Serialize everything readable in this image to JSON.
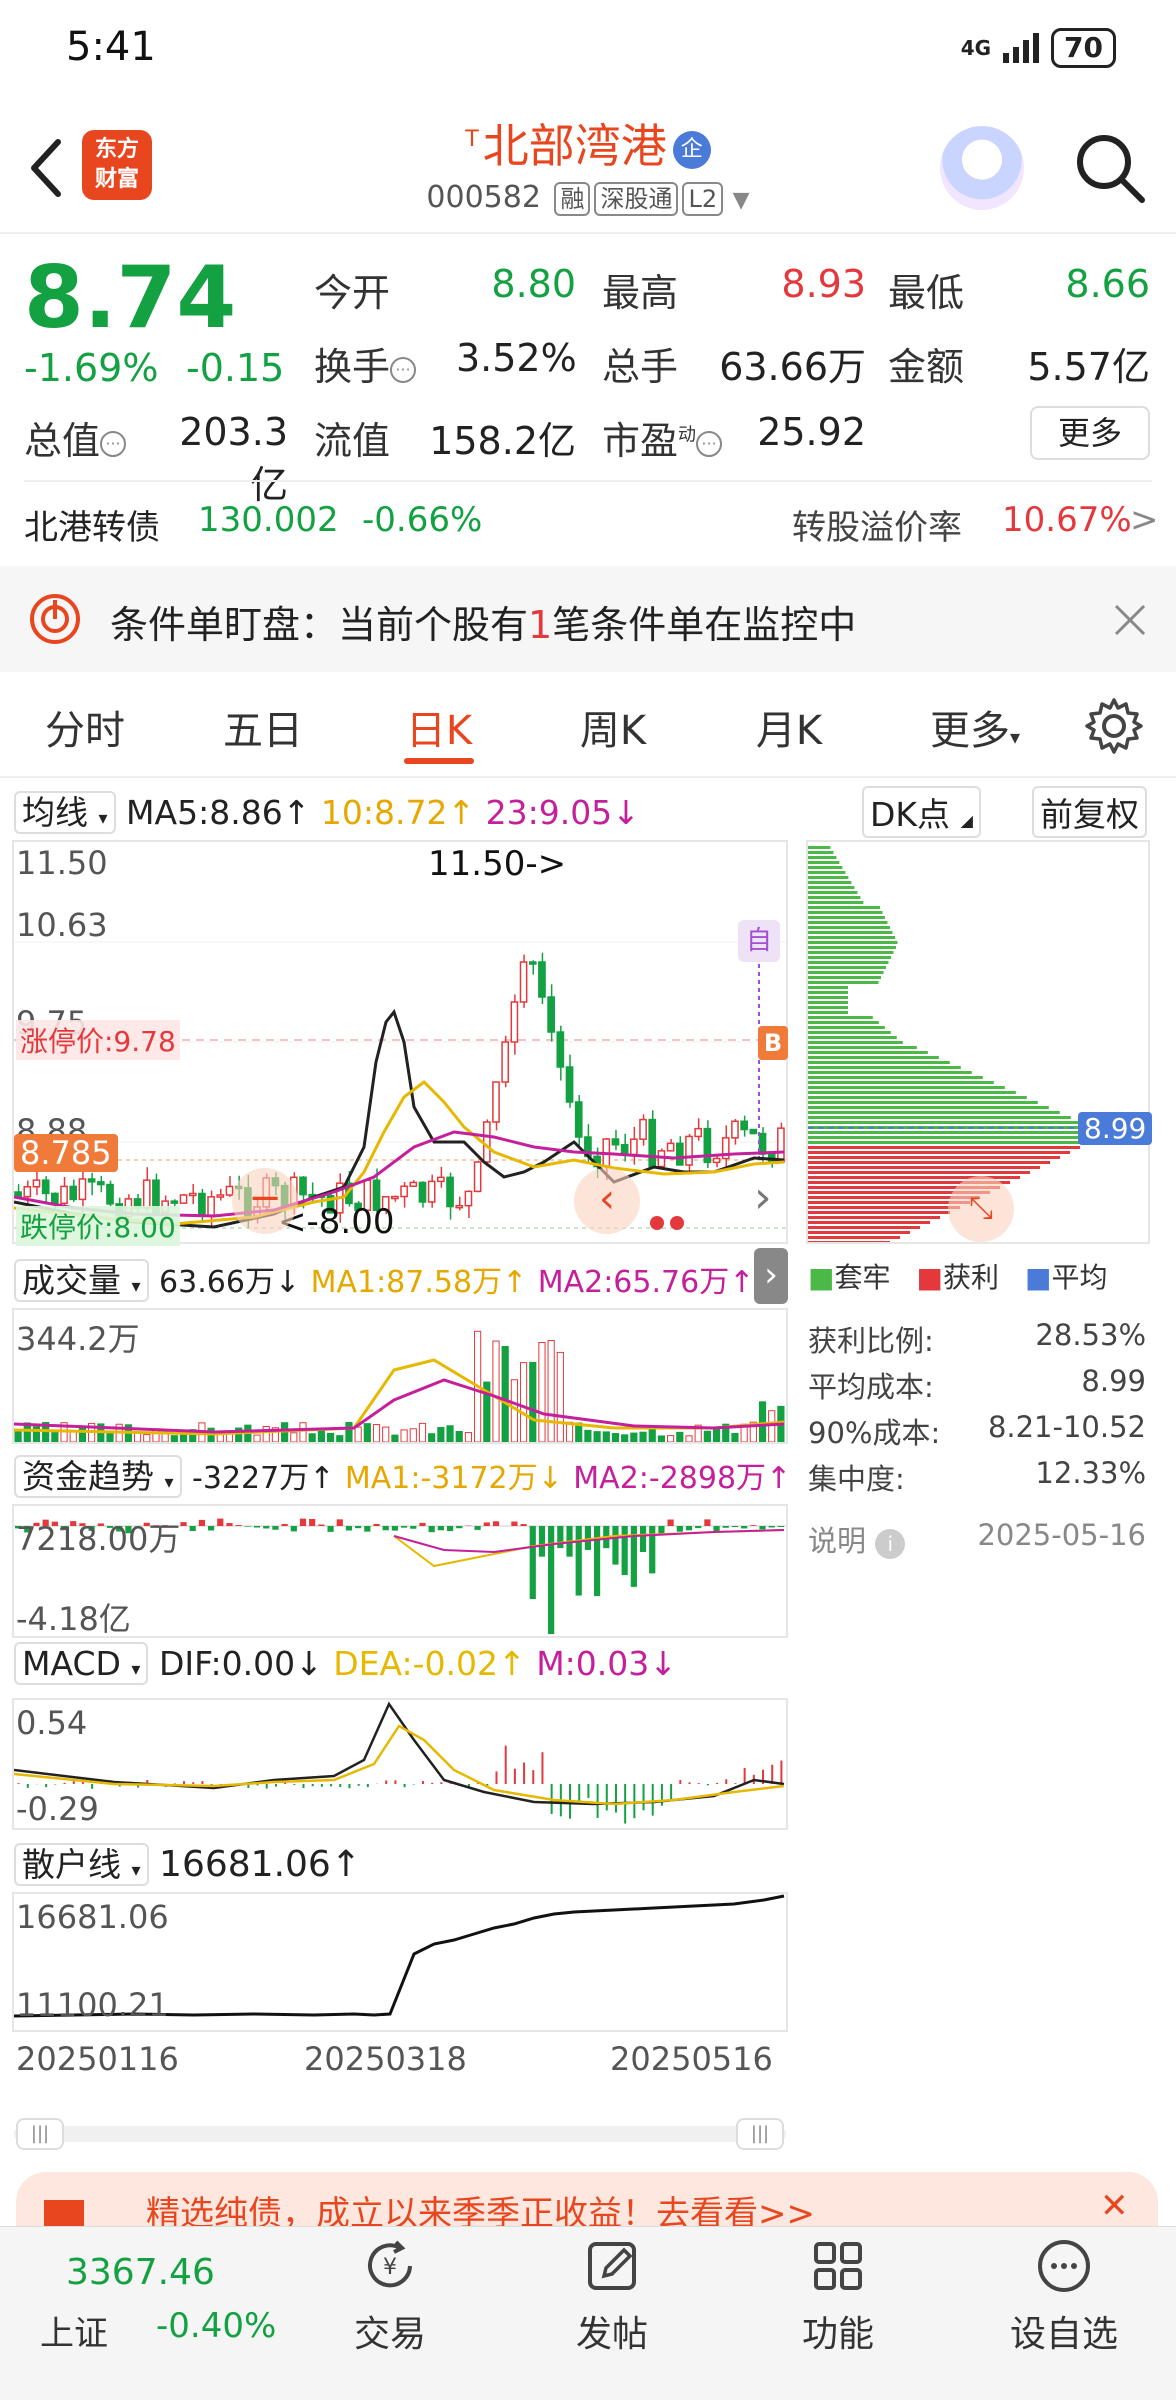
{
  "status": {
    "time": "5:41",
    "network": "4G",
    "battery": "70"
  },
  "header": {
    "app_logo": "东方\n财富",
    "name_prefix": "T",
    "stock_name": "北部湾港",
    "badge": "企",
    "code": "000582",
    "tags": [
      "融",
      "深股通",
      "L2"
    ]
  },
  "quote": {
    "price": "8.74",
    "change_pct": "-1.69%",
    "change": "-0.15",
    "market_cap_label": "总值",
    "market_cap": "203.3亿",
    "open_label": "今开",
    "open": "8.80",
    "high_label": "最高",
    "high": "8.93",
    "low_label": "最低",
    "low": "8.66",
    "turnover_label": "换手",
    "turnover": "3.52%",
    "volume_label": "总手",
    "volume": "63.66万",
    "amount_label": "金额",
    "amount": "5.57亿",
    "float_label": "流值",
    "float": "158.2亿",
    "pe_label": "市盈",
    "pe_sup": "动",
    "pe": "25.92",
    "more": "更多"
  },
  "bond": {
    "name": "北港转债",
    "price": "130.002",
    "pct": "-0.66%",
    "premium_label": "转股溢价率",
    "premium": "10.67%",
    "arrow": ">"
  },
  "condition_banner": {
    "text_a": "条件单盯盘：当前个股有",
    "count": "1",
    "text_b": "笔条件单在监控中"
  },
  "tabs": [
    "分时",
    "五日",
    "日K",
    "周K",
    "月K",
    "更多"
  ],
  "kline": {
    "ma_select": "均线",
    "ma5": "MA5:8.86↑",
    "ma10": "10:8.72↑",
    "ma23": "23:9.05↓",
    "dk_point": "DK点",
    "adjust": "前复权",
    "y_top": "11.50",
    "y_2": "10.63",
    "y_3": "9.75",
    "y_4": "8.88",
    "limit_up": "涨停价:9.78",
    "limit_down": "跌停价:8.00",
    "current_tag": "8.785",
    "max_marker": "11.50->",
    "min_marker": "<-8.00",
    "self_marker": "自",
    "b_marker": "B"
  },
  "chip": {
    "avg_tag": "8.99",
    "legend": [
      "套牢",
      "获利",
      "平均"
    ],
    "colors": {
      "trapped": "#4cb848",
      "profit": "#e4393c",
      "avg": "#4a7bd8"
    },
    "rows": [
      {
        "label": "获利比例:",
        "value": "28.53%"
      },
      {
        "label": "平均成本:",
        "value": "8.99"
      },
      {
        "label": "90%成本:",
        "value": "8.21-10.52"
      },
      {
        "label": "集中度:",
        "value": "12.33%"
      }
    ],
    "note": "说明",
    "date": "2025-05-16"
  },
  "volume": {
    "select": "成交量",
    "value": "63.66万↓",
    "ma1": "MA1:87.58万↑",
    "ma2": "MA2:65.76万↑",
    "y_top": "344.2万"
  },
  "fund": {
    "select": "资金趋势",
    "value": "-3227万↑",
    "ma1": "MA1:-3172万↓",
    "ma2": "MA2:-2898万↑",
    "y_top": "7218.00万",
    "y_bottom": "-4.18亿"
  },
  "macd": {
    "select": "MACD",
    "dif": "DIF:0.00↓",
    "dea": "DEA:-0.02↑",
    "m": "M:0.03↓",
    "y_top": "0.54",
    "y_bottom": "-0.29"
  },
  "retail": {
    "select": "散户线",
    "value": "16681.06↑",
    "y_top": "16681.06",
    "y_bottom": "11100.21"
  },
  "dates": [
    "20250116",
    "20250318",
    "20250516"
  ],
  "ad": {
    "text": "精选纯债，成立以来季季正收益！去看看>>"
  },
  "bottom_nav": {
    "index_value": "3367.46",
    "index_name": "上证",
    "index_pct": "-0.40%",
    "items": [
      "交易",
      "发帖",
      "功能",
      "设自选"
    ]
  }
}
